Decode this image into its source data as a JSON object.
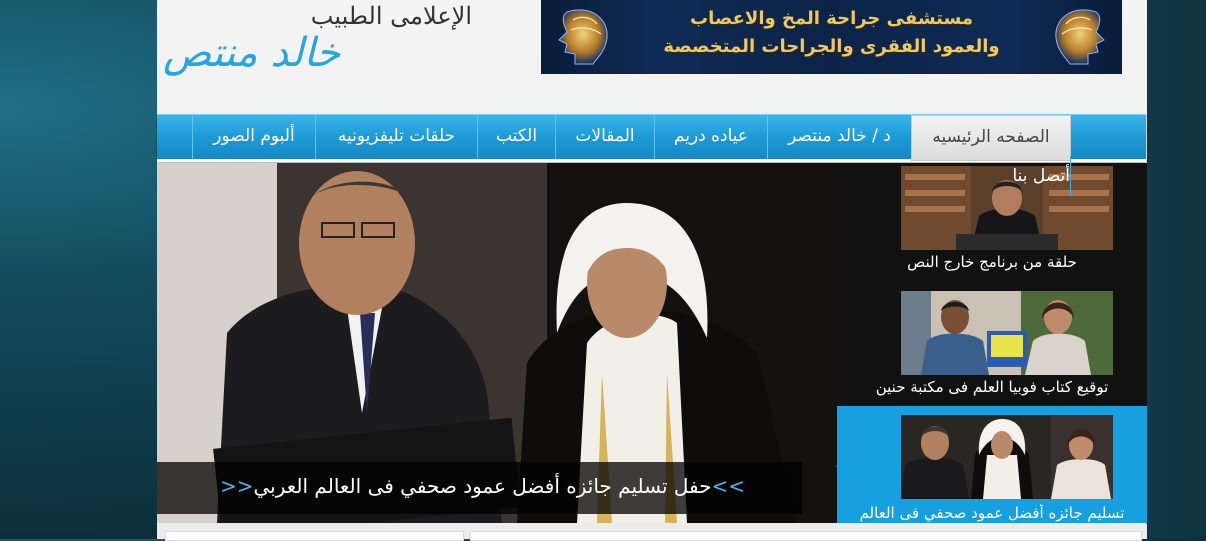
{
  "header": {
    "logo_subtitle": "الإعلامى الطبيب",
    "logo_title": "خالد منتص",
    "banner_line1": "مستشفى جراحة المخ والاعصاب",
    "banner_line2": "والعمود الفقرى والجراحات المتخصصة"
  },
  "nav": {
    "items": [
      {
        "label": "الصفحه الرئيسيه",
        "active": true
      },
      {
        "label": "د / خالد منتصر"
      },
      {
        "label": "عياده دريم"
      },
      {
        "label": "المقالات"
      },
      {
        "label": "الكتب"
      },
      {
        "label": "حلقات تليفزيونيه"
      },
      {
        "label": "ألبوم الصور"
      }
    ],
    "dropdown_item": "أتصل بنا"
  },
  "slider": {
    "caption": "حفل تسليم جائزه أفضل عمود صحفي فى العالم العربي",
    "prev_arrow": "<<",
    "next_arrow": ">>"
  },
  "thumbnails": [
    {
      "caption": "حلقة من برنامج خارج النص"
    },
    {
      "caption": "توقيع كتاب فوبيا العلم فى مكتبة حنين"
    },
    {
      "caption": "تسليم جائزه أفضل عمود صحفي فى العالم",
      "active": true
    }
  ],
  "colors": {
    "accent": "#17a0e0",
    "nav_blue": "#1e9bd7",
    "logo_blue": "#26a6dc",
    "banner_gold": "#e9c96a"
  }
}
